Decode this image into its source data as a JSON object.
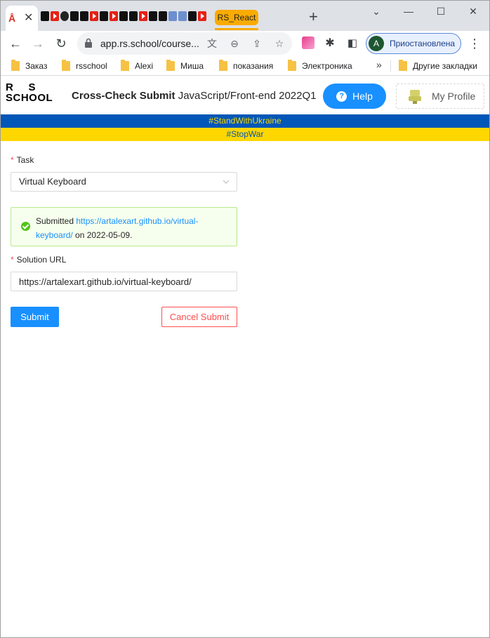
{
  "browser": {
    "tab_close_glyph": "✕",
    "tab_group_label": "RS_React",
    "new_tab_glyph": "+",
    "window_controls": {
      "minimize": "—",
      "maximize": "☐",
      "close": "✕"
    },
    "address": "app.rs.school/course...",
    "profile_initial": "A",
    "profile_label": "Приостановлена",
    "bookmarks": [
      "Заказ",
      "rsschool",
      "Alexi",
      "Миша",
      "показания",
      "Электроника"
    ],
    "bookmarks_more_glyph": "»",
    "other_bookmarks": "Другие закладки"
  },
  "header": {
    "logo_line1": "R    S",
    "logo_line2": "SCHOOL",
    "title_bold": "Cross-Check Submit",
    "title_rest": " JavaScript/Front-end 2022Q1",
    "help_label": "Help",
    "profile_label": "My Profile"
  },
  "banners": {
    "top": "#StandWithUkraine",
    "bottom": "#StopWar"
  },
  "form": {
    "task_label": "Task",
    "required_mark": "*",
    "task_value": "Virtual Keyboard",
    "alert_prefix": "Submitted ",
    "alert_link": "https://artalexart.github.io/virtual-keyboard/",
    "alert_suffix": " on 2022-05-09.",
    "solution_label": "Solution URL",
    "solution_value": "https://artalexart.github.io/virtual-keyboard/",
    "submit_label": "Submit",
    "cancel_label": "Cancel Submit"
  },
  "colors": {
    "primary": "#1890ff",
    "danger": "#ff4d4f",
    "success": "#52c41a",
    "ukraine_blue": "#0057b7",
    "ukraine_yellow": "#ffd700"
  }
}
